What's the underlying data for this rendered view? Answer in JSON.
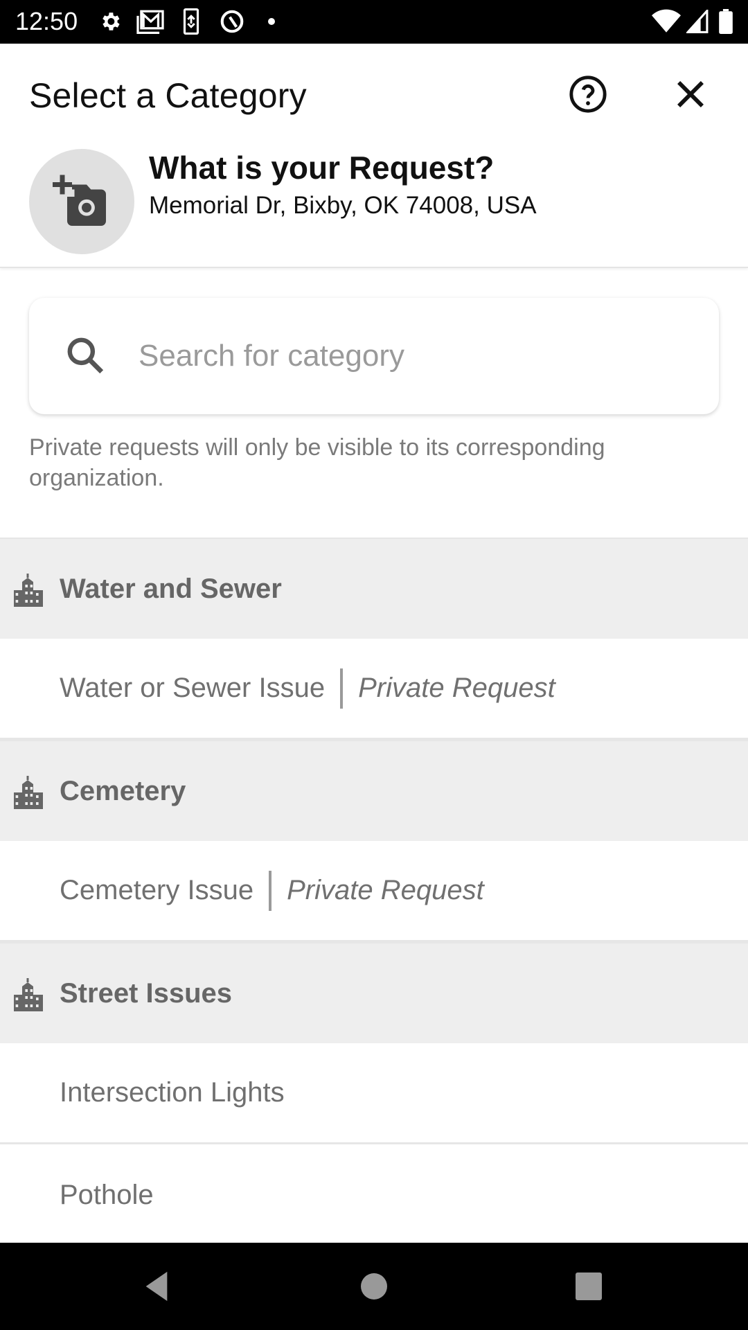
{
  "status_bar": {
    "time": "12:50",
    "left_icons": [
      "settings-icon",
      "gmail-icon",
      "sync-icon",
      "data-saver-icon",
      "dot-icon"
    ],
    "right_icons": [
      "wifi-icon",
      "cellular-signal-icon",
      "battery-icon"
    ]
  },
  "header": {
    "title": "Select a Category",
    "help_icon": "help-circle-icon",
    "close_icon": "close-icon",
    "photo_icon": "add-photo-icon",
    "request_title": "What is your Request?",
    "address": "Memorial Dr, Bixby, OK 74008, USA"
  },
  "search": {
    "placeholder": "Search for category",
    "value": ""
  },
  "note": "Private requests will only be visible to its corresponding organization.",
  "groups": [
    {
      "name": "Water and Sewer",
      "icon": "building-icon",
      "items": [
        {
          "name": "Water or Sewer Issue",
          "tag": "Private Request"
        }
      ]
    },
    {
      "name": "Cemetery",
      "icon": "building-icon",
      "items": [
        {
          "name": "Cemetery Issue",
          "tag": "Private Request"
        }
      ]
    },
    {
      "name": "Street Issues",
      "icon": "building-icon",
      "items": [
        {
          "name": "Intersection Lights"
        },
        {
          "name": "Pothole"
        }
      ]
    }
  ],
  "nav_bar": {
    "buttons": [
      "back-icon",
      "home-icon",
      "recents-icon"
    ]
  }
}
